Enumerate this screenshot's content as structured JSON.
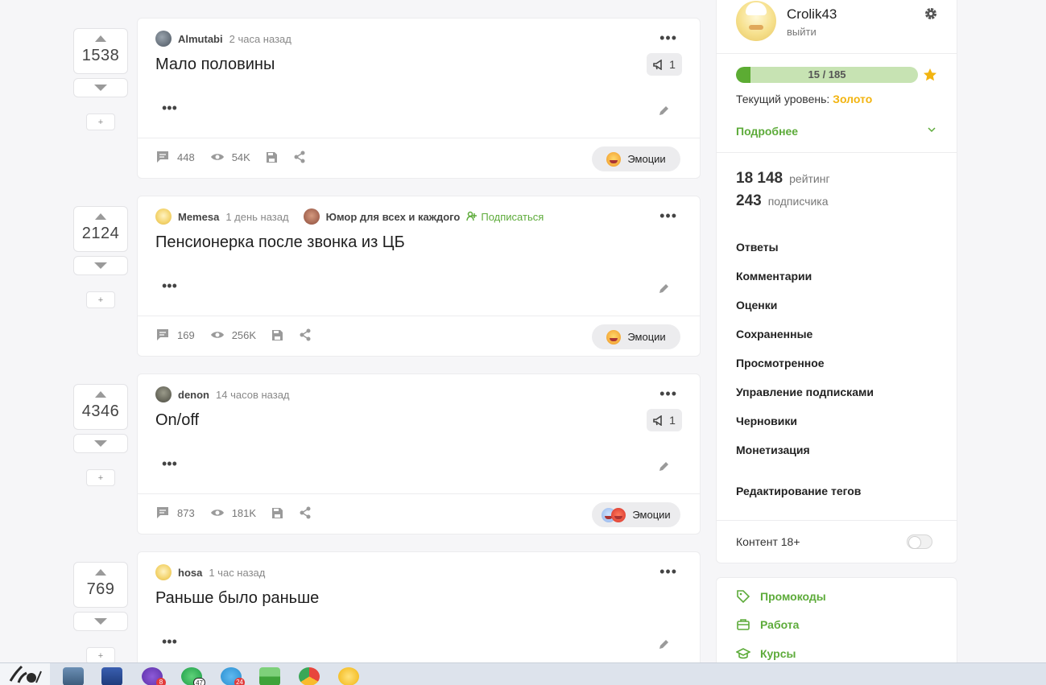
{
  "posts": [
    {
      "rating": "1538",
      "author": "Almutabi",
      "time": "2 часа назад",
      "title": "Мало половины",
      "badge": "1",
      "comments": "448",
      "views": "54K",
      "emotions_label": "Эмоции"
    },
    {
      "rating": "2124",
      "author": "Memesa",
      "time": "1 день назад",
      "community": "Юмор для всех и каждого",
      "subscribe": "Подписаться",
      "title": "Пенсионерка после звонка из ЦБ",
      "comments": "169",
      "views": "256K",
      "emotions_label": "Эмоции"
    },
    {
      "rating": "4346",
      "author": "denon",
      "time": "14 часов назад",
      "title": "On/off",
      "badge": "1",
      "comments": "873",
      "views": "181K",
      "emotions_label": "Эмоции"
    },
    {
      "rating": "769",
      "author": "hosa",
      "time": "1 час назад",
      "title": "Раньше было раньше"
    }
  ],
  "vote_plus": "+",
  "sidebar": {
    "username": "Crolik43",
    "logout": "выйти",
    "progress_text": "15 / 185",
    "progress_fraction": 0.081,
    "level_label": "Текущий уровень:",
    "level_value": "Золото",
    "more": "Подробнее",
    "rating_value": "18 148",
    "rating_label": "рейтинг",
    "subscribers_value": "243",
    "subscribers_label": "подписчика",
    "links": [
      "Ответы",
      "Комментарии",
      "Оценки",
      "Сохраненные",
      "Просмотренное",
      "Управление подписками",
      "Черновики",
      "Монетизация"
    ],
    "edit_tags": "Редактирование тегов",
    "nsfw_label": "Контент 18+",
    "nsfw_enabled": false
  },
  "sidebar2": {
    "links": [
      "Промокоды",
      "Работа",
      "Курсы"
    ]
  },
  "taskbar": {
    "viber_badge": "8",
    "whatsapp_badge": "47",
    "telegram_badge": "24"
  },
  "colors": {
    "accent_green": "#5dab3a",
    "gold": "#f2b410",
    "progress_bg": "#c7e3b3"
  }
}
